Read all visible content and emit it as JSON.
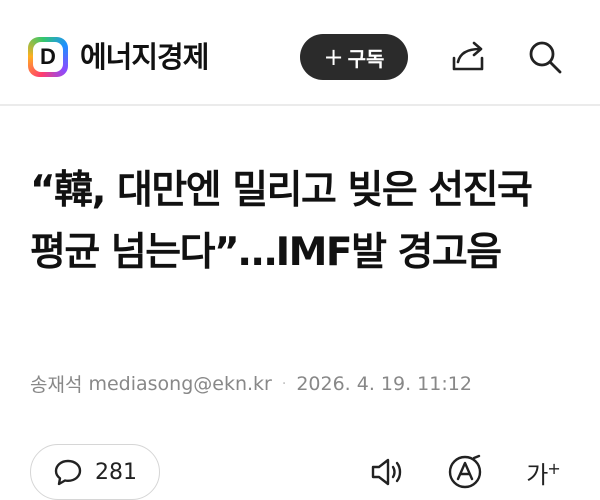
{
  "header": {
    "logo_letter": "D",
    "brand": "에너지경제",
    "subscribe_plus": "+",
    "subscribe_label": "구독",
    "icons": [
      "share-icon",
      "search-icon"
    ]
  },
  "article": {
    "headline": "“韓, 대만엔 밀리고 빚은 선진국 평균 넘는다”…IMF발 경고음",
    "author": "송재석",
    "email": "mediasong@ekn.kr",
    "separator": "·",
    "datetime": "2026. 4. 19. 11:12"
  },
  "toolbar": {
    "comment_count": "281",
    "textsize_label": "가",
    "textsize_sup": "+",
    "icons": [
      "comment-icon",
      "speaker-icon",
      "font-icon",
      "text-size-icon"
    ]
  },
  "colors": {
    "subscribe_bg": "#2b2b2b",
    "meta_text": "#888888",
    "divider": "#ebebeb"
  }
}
